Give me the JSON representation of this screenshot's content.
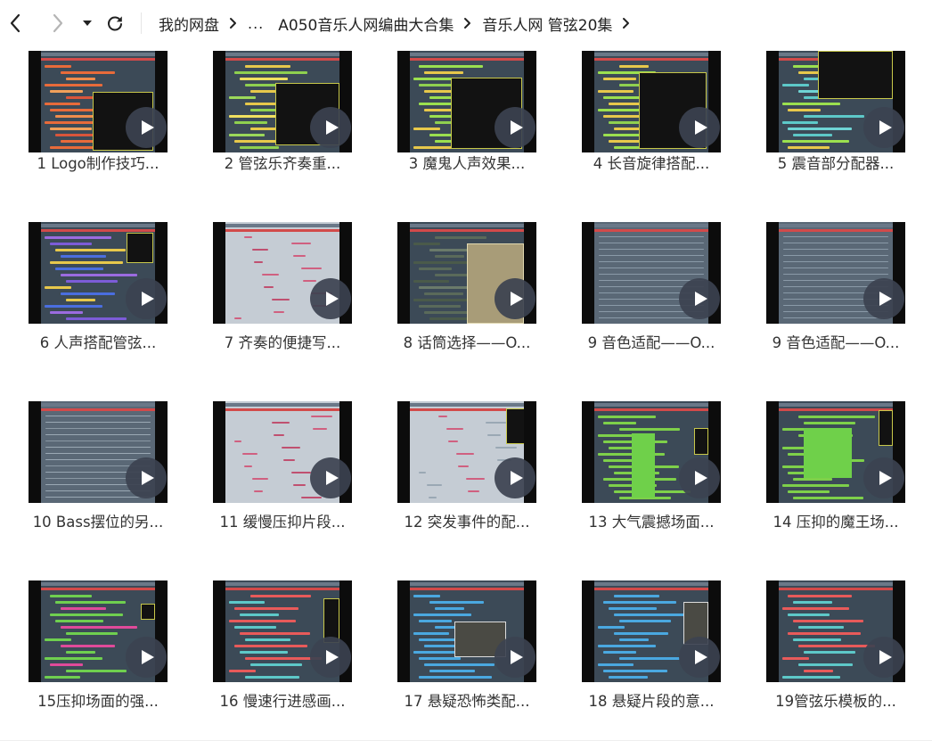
{
  "toolbar": {
    "back_icon": "chevron-left-icon",
    "forward_icon": "chevron-right-icon",
    "history_icon": "caret-down-icon",
    "refresh_icon": "refresh-icon"
  },
  "breadcrumb": {
    "items": [
      "我的网盘",
      "...",
      "A050音乐人网编曲大合集",
      "音乐人网 管弦20集"
    ]
  },
  "videos": [
    {
      "title": "1 Logo制作技巧...",
      "thumb": "logo"
    },
    {
      "title": "2 管弦乐齐奏重...",
      "thumb": "tutti"
    },
    {
      "title": "3 魔鬼人声效果...",
      "thumb": "voice"
    },
    {
      "title": "4 长音旋律搭配...",
      "thumb": "longnote"
    },
    {
      "title": "5 震音部分配器...",
      "thumb": "tremolo"
    },
    {
      "title": "6 人声搭配管弦...",
      "thumb": "vocal"
    },
    {
      "title": "7 齐奏的便捷写...",
      "thumb": "pianoroll"
    },
    {
      "title": "8 话筒选择——O...",
      "thumb": "plugin"
    },
    {
      "title": "9 音色适配——O...",
      "thumb": "mixer"
    },
    {
      "title": "9 音色适配——O...",
      "thumb": "mixer"
    },
    {
      "title": "10 Bass摆位的另...",
      "thumb": "bass"
    },
    {
      "title": "11 缓慢压抑片段...",
      "thumb": "pianoroll2"
    },
    {
      "title": "12 突发事件的配...",
      "thumb": "event"
    },
    {
      "title": "13 大气震撼场面...",
      "thumb": "green"
    },
    {
      "title": "14 压抑的魔王场...",
      "thumb": "green2"
    },
    {
      "title": "15压抑场面的强...",
      "thumb": "dark"
    },
    {
      "title": "16 慢速行进感画...",
      "thumb": "slow"
    },
    {
      "title": "17 悬疑恐怖类配...",
      "thumb": "suspense"
    },
    {
      "title": "18 悬疑片段的意...",
      "thumb": "suspense2"
    },
    {
      "title": "19管弦乐模板的...",
      "thumb": "template"
    }
  ],
  "colors": {
    "play_bg": "#3c4250",
    "thumb_bg": "#0c0c0c",
    "daw_bg": "#3c4a57"
  },
  "play_icon": "play-icon"
}
